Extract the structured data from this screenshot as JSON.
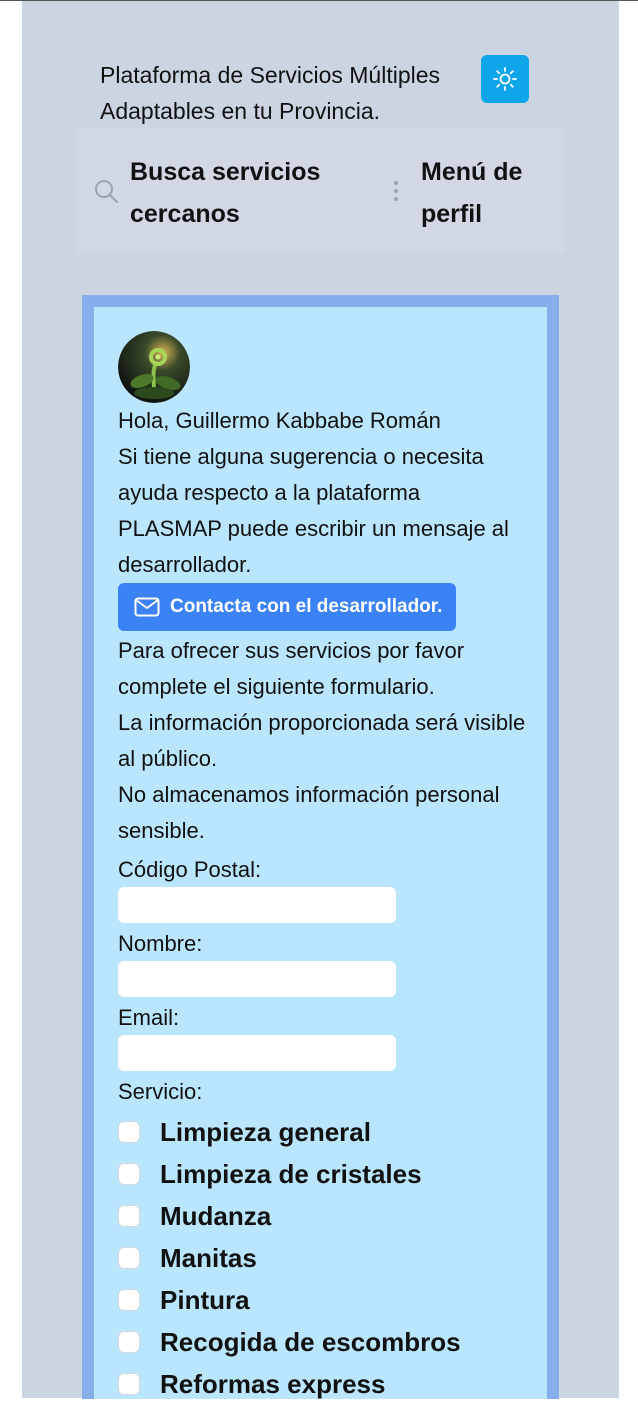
{
  "header": {
    "title": "Plataforma de Servicios Múltiples Adaptables en tu Provincia."
  },
  "theme_toggle": {
    "icon": "sun-icon"
  },
  "topbar": {
    "search_label": "Busca servicios cercanos",
    "profile_label": "Menú de perfil"
  },
  "greeting": "Hola, Guillermo Kabbabe Román",
  "suggestion_text": "Si tiene alguna sugerencia o necesita ayuda respecto a la plataforma PLASMAP puede escribir un mensaje al desarrollador.",
  "contact_button_label": "Contacta con el desarrollador.",
  "form_intro": [
    "Para ofrecer sus servicios por favor complete el siguiente formulario.",
    "La información proporcionada será visible al público.",
    "No almacenamos información personal sensible."
  ],
  "form": {
    "postal_label": "Código Postal:",
    "postal_value": "",
    "name_label": "Nombre:",
    "name_value": "",
    "email_label": "Email:",
    "email_value": "",
    "service_label": "Servicio:",
    "services": [
      "Limpieza general",
      "Limpieza de cristales",
      "Mudanza",
      "Manitas",
      "Pintura",
      "Recogida de escombros",
      "Reformas express"
    ]
  },
  "colors": {
    "page_bg": "#cbd5e1",
    "accent_sky": "#0ea5e9",
    "button_blue": "#3b82f6",
    "card_border": "#86aeea",
    "card_bg": "#bae6fd"
  }
}
